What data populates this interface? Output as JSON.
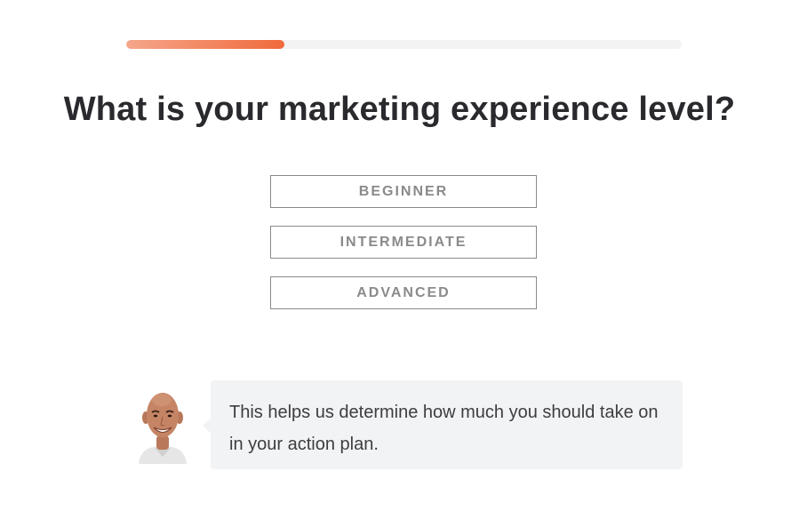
{
  "progress": {
    "fraction": 0.285
  },
  "question": {
    "title": "What is your marketing experience level?"
  },
  "options": [
    {
      "label": "BEGINNER"
    },
    {
      "label": "INTERMEDIATE"
    },
    {
      "label": "ADVANCED"
    }
  ],
  "hint": {
    "text": "This helps us determine how much you should take on in your action plan.",
    "avatar_icon": "person-portrait-icon"
  },
  "colors": {
    "accent_start": "#f5a68a",
    "accent_end": "#f06a3c",
    "heading": "#2a2a2e",
    "option_text": "#8a8a8a",
    "bubble_bg": "#f2f3f4"
  }
}
